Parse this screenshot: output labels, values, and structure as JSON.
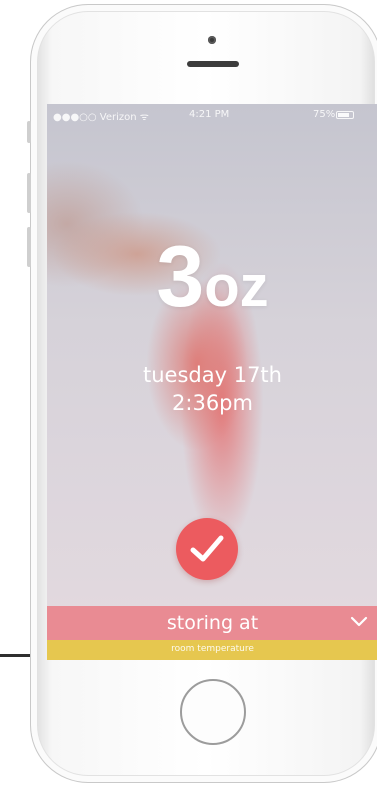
{
  "status_bar": {
    "carrier": "●●●○○ Verizon ᯤ",
    "time": "4:21 PM",
    "battery": "75%"
  },
  "feed": {
    "amount_number": "3",
    "amount_unit": "oz",
    "day": "tuesday 17th",
    "time": "2:36pm"
  },
  "storage": {
    "label": "storing at",
    "selected_option": "room temperature"
  },
  "icons": {
    "confirm": "check-icon",
    "dropdown": "chevron-down-icon"
  },
  "colors": {
    "confirm_button": "#ec5b5f",
    "storing_bar": "#e98b93",
    "option_bar": "#e6c74f"
  }
}
